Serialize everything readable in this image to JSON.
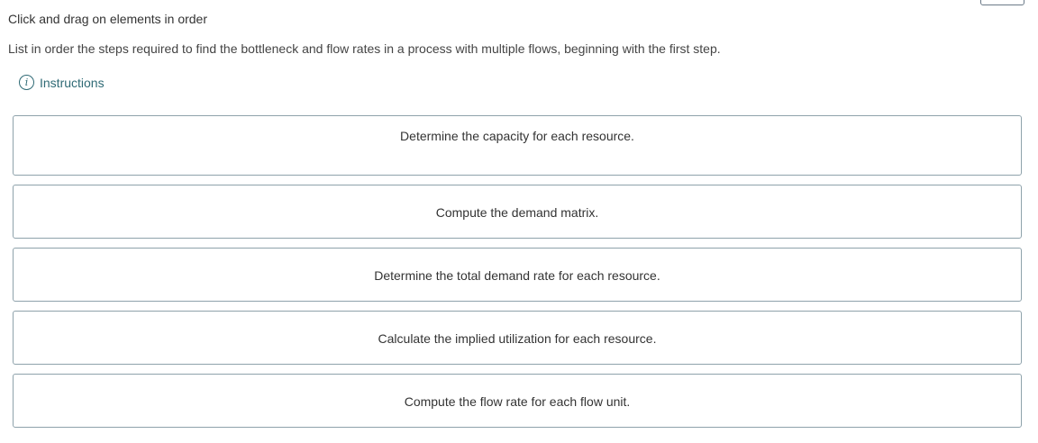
{
  "header": {
    "title": "Click and drag on elements in order"
  },
  "question": {
    "text": "List in order the steps required to find the bottleneck and flow rates in a process with multiple flows, beginning with the first step."
  },
  "instructions": {
    "icon": "info-icon",
    "label": "Instructions"
  },
  "steps": [
    {
      "label": "Determine the capacity for each resource."
    },
    {
      "label": "Compute the demand matrix."
    },
    {
      "label": "Determine the total demand rate for each resource."
    },
    {
      "label": "Calculate the implied utilization for each resource."
    },
    {
      "label": "Compute the flow rate for each flow unit."
    }
  ]
}
